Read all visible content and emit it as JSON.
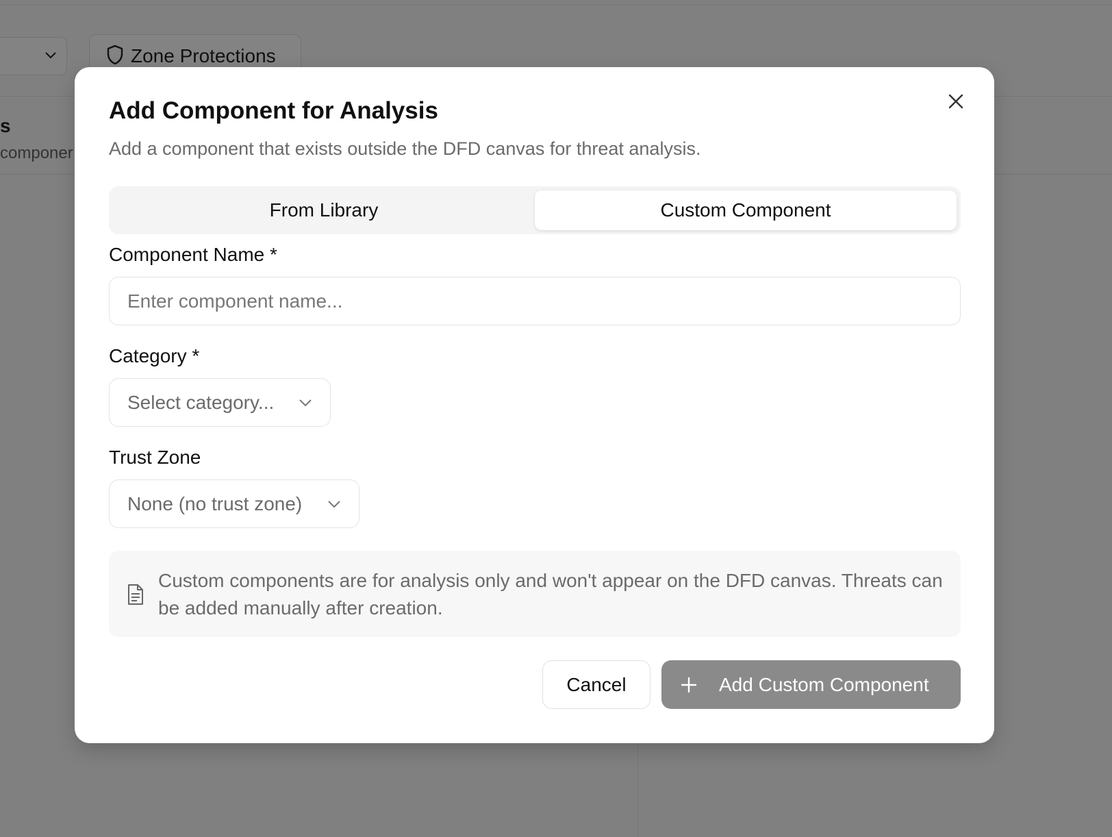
{
  "background": {
    "zone_tab_label": "Zone Protections",
    "partial_heading": "s",
    "partial_subtext": "componer"
  },
  "modal": {
    "title": "Add Component for Analysis",
    "subtitle": "Add a component that exists outside the DFD canvas for threat analysis.",
    "tabs": [
      {
        "label": "From Library",
        "active": false
      },
      {
        "label": "Custom Component",
        "active": true
      }
    ],
    "fields": {
      "name": {
        "label": "Component Name *",
        "placeholder": "Enter component name...",
        "value": ""
      },
      "category": {
        "label": "Category *",
        "value": "Select category..."
      },
      "trust_zone": {
        "label": "Trust Zone",
        "value": "None (no trust zone)"
      }
    },
    "info_text": "Custom components are for analysis only and won't appear on the DFD canvas. Threats can be added manually after creation.",
    "buttons": {
      "cancel": "Cancel",
      "add": "Add Custom Component"
    }
  },
  "colors": {
    "overlay": "#808080",
    "primary_disabled": "#8a8a8a",
    "muted_text": "#6b6b6b"
  },
  "icons": [
    "chevron-down-icon",
    "shield-icon",
    "close-icon",
    "document-icon",
    "plus-icon"
  ]
}
